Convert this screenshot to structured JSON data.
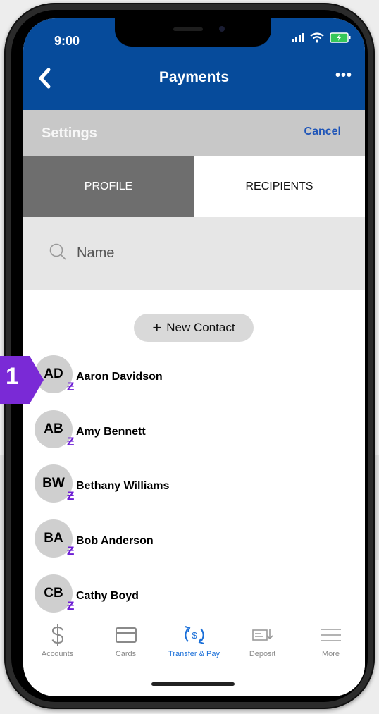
{
  "status": {
    "time": "9:00"
  },
  "header": {
    "title": "Payments",
    "more": "•••"
  },
  "settings": {
    "title": "Settings",
    "cancel": "Cancel"
  },
  "tabs": [
    {
      "label": "PROFILE"
    },
    {
      "label": "RECIPIENTS"
    }
  ],
  "search": {
    "placeholder": "Name"
  },
  "new_contact": {
    "label": "New Contact",
    "icon": "+"
  },
  "contacts": [
    {
      "initials": "AD",
      "name": "Aaron Davidson",
      "badge": "Ƶ"
    },
    {
      "initials": "AB",
      "name": "Amy Bennett",
      "badge": "Ƶ"
    },
    {
      "initials": "BW",
      "name": "Bethany Williams",
      "badge": "Ƶ"
    },
    {
      "initials": "BA",
      "name": "Bob Anderson",
      "badge": "Ƶ"
    },
    {
      "initials": "CB",
      "name": "Cathy Boyd",
      "badge": "Ƶ"
    }
  ],
  "tabbar": [
    {
      "label": "Accounts",
      "icon": "dollar-icon"
    },
    {
      "label": "Cards",
      "icon": "card-icon"
    },
    {
      "label": "Transfer & Pay",
      "icon": "transfer-icon",
      "active": true
    },
    {
      "label": "Deposit",
      "icon": "check-deposit-icon"
    },
    {
      "label": "More",
      "icon": "menu-icon"
    }
  ],
  "callout": {
    "number": "1"
  },
  "colors": {
    "primary": "#064b9b",
    "zelle": "#6d1ed4",
    "callout": "#7a2ad6",
    "active_tab": "#1a6fd8"
  }
}
